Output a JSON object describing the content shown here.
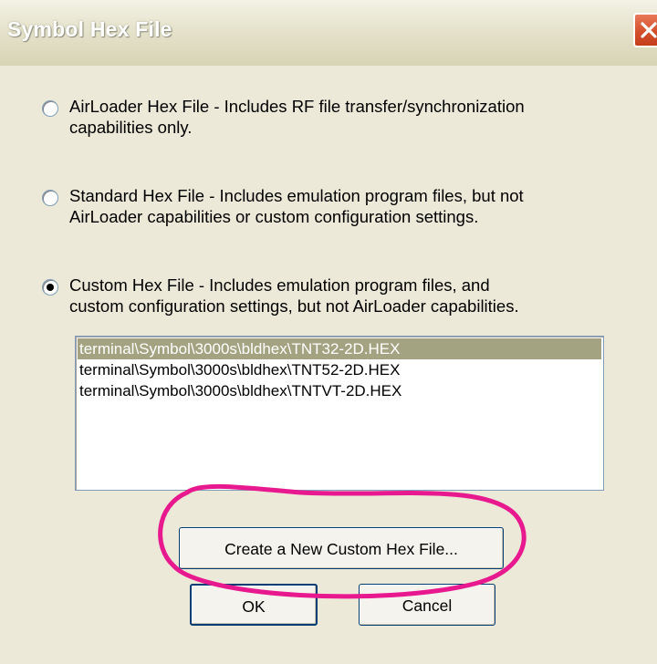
{
  "window": {
    "title": "Symbol Hex File"
  },
  "options": [
    {
      "line1": "AirLoader Hex File  -  Includes RF file transfer/synchronization",
      "line2": "capabilities only.",
      "selected": false
    },
    {
      "line1": "Standard Hex File  -  Includes emulation program files, but not",
      "line2": "AirLoader capabilities or custom configuration settings.",
      "selected": false
    },
    {
      "line1": "Custom Hex File  -  Includes emulation program files, and",
      "line2": "custom configuration settings, but not AirLoader capabilities.",
      "selected": true
    }
  ],
  "file_list": [
    "terminal\\Symbol\\3000s\\bldhex\\TNT32-2D.HEX",
    "terminal\\Symbol\\3000s\\bldhex\\TNT52-2D.HEX",
    "terminal\\Symbol\\3000s\\bldhex\\TNTVT-2D.HEX"
  ],
  "buttons": {
    "create_label": "Create a New Custom Hex File...",
    "ok_label": "OK",
    "cancel_label": "Cancel"
  },
  "colors": {
    "selection": "#a3a381",
    "annotation": "#e8198f",
    "close_button": "#d4502c"
  },
  "icons": {
    "close": "close-x-icon",
    "radio_checked": "radio-checked",
    "radio_unchecked": "radio-unchecked"
  }
}
